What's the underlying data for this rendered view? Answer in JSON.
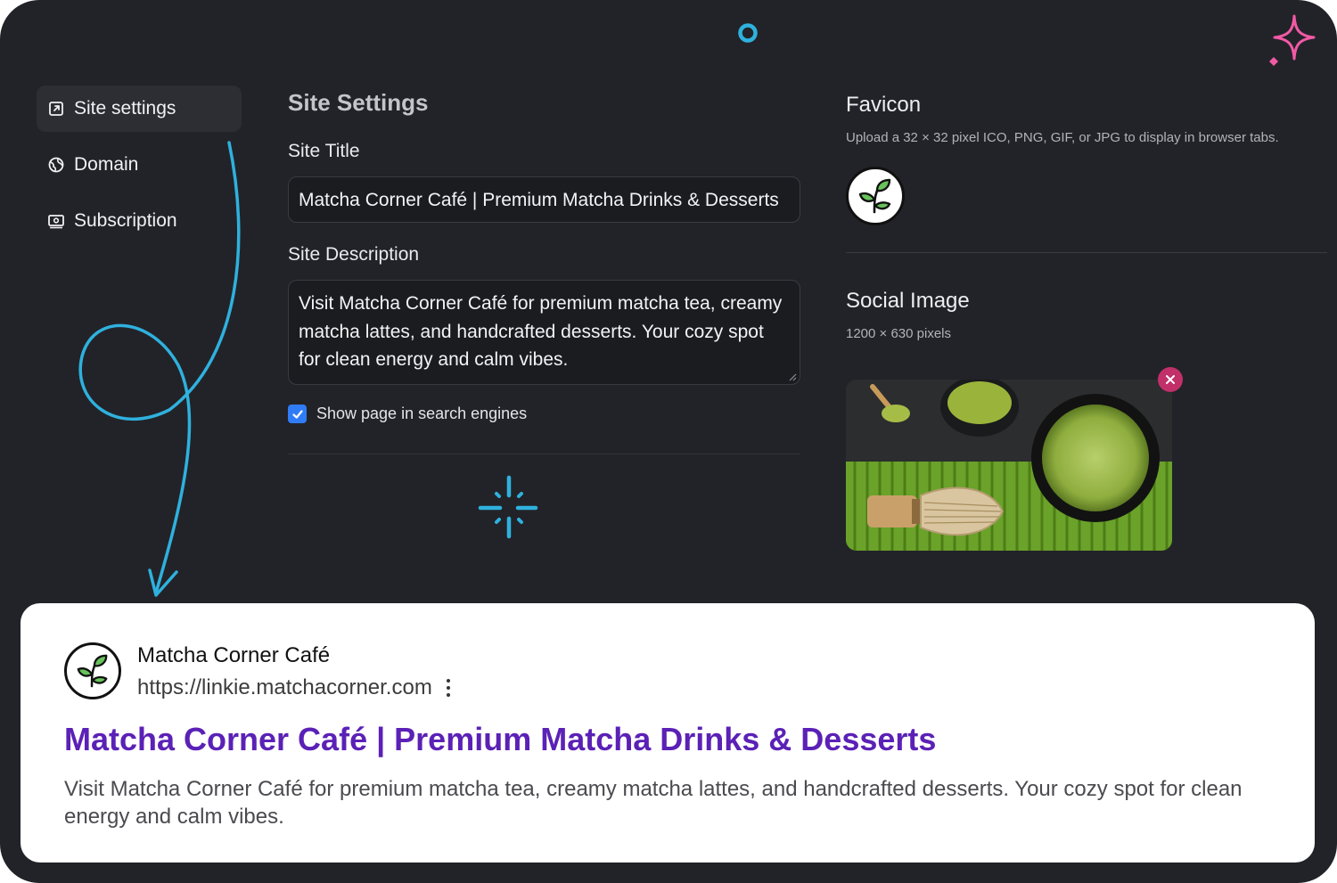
{
  "sidebar": {
    "items": [
      {
        "label": "Site settings",
        "icon": "external-link-square-icon",
        "active": true
      },
      {
        "label": "Domain",
        "icon": "globe-icon",
        "active": false
      },
      {
        "label": "Subscription",
        "icon": "banknote-icon",
        "active": false
      }
    ]
  },
  "form": {
    "heading": "Site Settings",
    "site_title_label": "Site Title",
    "site_title_value": "Matcha Corner Café | Premium Matcha Drinks & Desserts",
    "site_description_label": "Site Description",
    "site_description_value": "Visit Matcha Corner Café for premium matcha tea, creamy matcha lattes, and handcrafted desserts. Your cozy spot for clean energy and calm vibes.",
    "search_engines_label": "Show page in search engines",
    "search_engines_checked": true
  },
  "favicon": {
    "title": "Favicon",
    "subtitle": "Upload a 32 × 32 pixel ICO, PNG, GIF, or JPG to display in browser tabs.",
    "icon": "sprout-leaf-icon"
  },
  "social_image": {
    "title": "Social Image",
    "subtitle": "1200 × 630 pixels",
    "remove_icon": "close-icon"
  },
  "preview": {
    "site_name": "Matcha Corner Café",
    "url": "https://linkie.matchacorner.com",
    "title": "Matcha Corner Café | Premium Matcha Drinks & Desserts",
    "description": "Visit Matcha Corner Café for premium matcha tea, creamy matcha lattes, and handcrafted desserts. Your cozy spot for clean energy and calm vibes.",
    "menu_icon": "more-vertical-icon"
  },
  "colors": {
    "frame_bg": "#222328",
    "accent_blue": "#2fb1de",
    "accent_pink": "#f25aa6",
    "preview_title": "#5b21b6",
    "checkbox": "#2f7cf6"
  }
}
